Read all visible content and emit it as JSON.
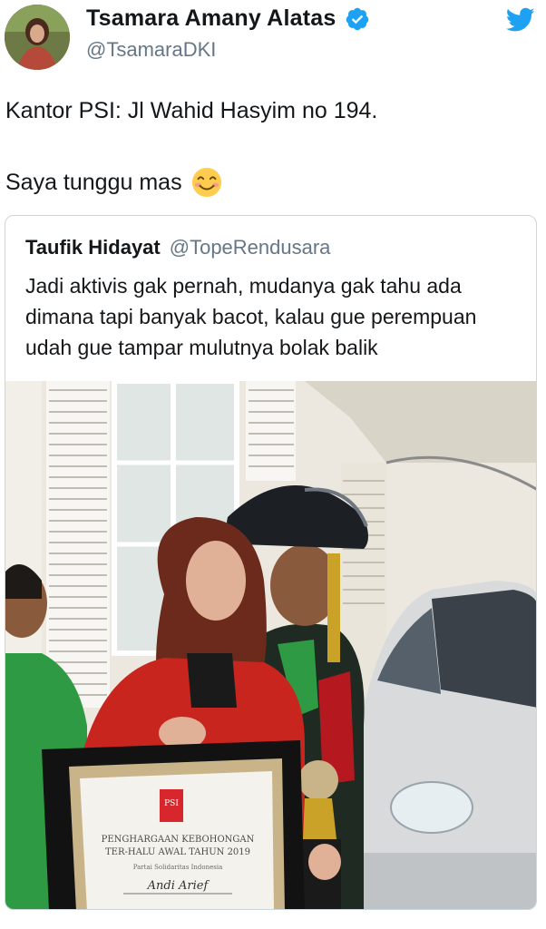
{
  "author": {
    "display_name": "Tsamara Amany Alatas",
    "handle": "@TsamaraDKI",
    "verified": true,
    "avatar_icon": "profile-photo",
    "brand_color": "#1da1f2"
  },
  "tweet": {
    "line1": "Kantor PSI: Jl Wahid Hasyim no 194.",
    "line2": "Saya tunggu mas",
    "emoji": "smiling-face-with-smiling-eyes"
  },
  "quoted_tweet": {
    "display_name": "Taufik Hidayat",
    "handle": "@TopeRendusara",
    "text": "Jadi aktivis gak pernah, mudanya gak tahu ada dimana tapi banyak bacot, kalau gue perempuan udah gue tampar mulutnya bolak balik",
    "photo": {
      "description_icon": "attached-photo",
      "certificate": {
        "heading_line1": "PENGHARGAAN KEBOHONGAN",
        "heading_line2": "TER-HALU AWAL TAHUN 2019",
        "org": "Partai Solidaritas Indonesia",
        "recipient": "Andi Arief",
        "logo_text": "PSI"
      }
    }
  }
}
